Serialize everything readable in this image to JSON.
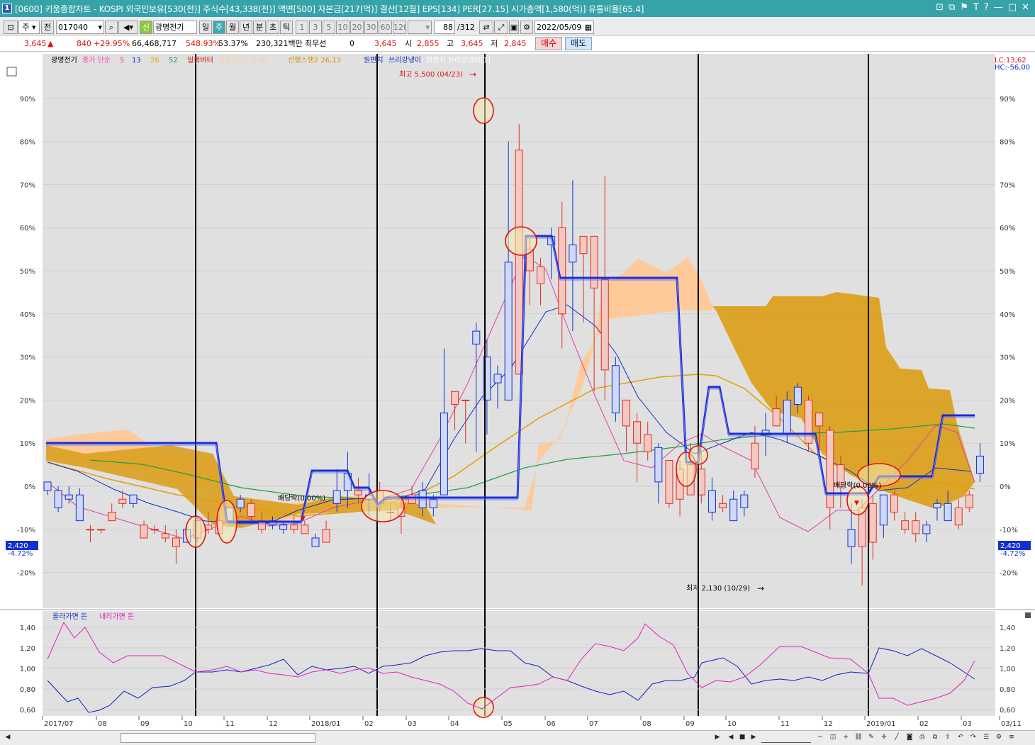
{
  "window": {
    "number": "1",
    "title": "[0600] 키움종합차트 - KOSPI 외국인보유[530(천)] 주식수[43,338(천)] 액면[500] 자본금[217(억)] 결산[12월] EPS[134] PER[27.15] 시가총액[1,580(억)] 유통비율[65.4]",
    "buttons": [
      "⊡",
      "⧉",
      "⚑",
      "T",
      "?",
      "—",
      "□",
      "✕"
    ]
  },
  "toolbar": {
    "period_type": "주",
    "period_all": "전",
    "code": "017040",
    "badge": "신",
    "name": "광명전기",
    "periods": [
      "일",
      "주",
      "월",
      "년",
      "분",
      "초",
      "틱"
    ],
    "active_period": "주",
    "intervals": [
      "1",
      "3",
      "5",
      "10",
      "20",
      "30",
      "60",
      "120"
    ],
    "count": "88",
    "count_total": "/312",
    "date": "2022/05/09"
  },
  "quote": {
    "price": "3,645",
    "change": "840",
    "change_pct": "+29.95%",
    "volume": "66,468,717",
    "vol_ratio": "548.93%",
    "turnover": "53.37%",
    "amount": "230,321백만",
    "pref_label": "최우선",
    "pref_value": "0",
    "bid_price": "3,645",
    "open_label": "시",
    "open": "2,855",
    "high_label": "고",
    "high": "3,645",
    "low_label": "저",
    "low": "2,845",
    "buy": "매수",
    "sell": "매도"
  },
  "legend": {
    "items": [
      {
        "text": "광명전기",
        "color": "#000000"
      },
      {
        "text": "종가 단순",
        "color": "#ff40c0"
      },
      {
        "text": "5",
        "color": "#e040a0"
      },
      {
        "text": "13",
        "color": "#1030c0"
      },
      {
        "text": "26",
        "color": "#e0a000"
      },
      {
        "text": "52",
        "color": "#10a040"
      },
      {
        "text": "일목버터",
        "color": "#e01010"
      },
      {
        "text": "선행스팬1 5.10",
        "color": "#ffcc99"
      },
      {
        "text": "선행스팬2 26,13",
        "color": "#d89000"
      },
      {
        "text": "원편치",
        "color": "#1030c0"
      },
      {
        "text": "쓰리강냉이",
        "color": "#1030c0"
      },
      {
        "text": "원편치 쓰리강냉이[1]",
        "color": "#ffffff"
      }
    ],
    "lc": "LC:13,62",
    "hc": "HC:-56,00"
  },
  "annotations": {
    "high": "최고 5,500 (04/23)",
    "low": "최저 2,130 (10/29)",
    "div1": "배당락(0.00%)",
    "div2": "배당락(0.00%)",
    "cur_price": "2,420",
    "cur_pct": "-4.72%"
  },
  "axis": {
    "y_ticks": [
      "90%",
      "80%",
      "70%",
      "60%",
      "50%",
      "40%",
      "30%",
      "20%",
      "10%",
      "0%",
      "-10%",
      "-20%"
    ],
    "x_ticks": [
      "2017/07",
      "08",
      "09",
      "10",
      "11",
      "12",
      "2018/01",
      "02",
      "03",
      "04",
      "05",
      "06",
      "07",
      "08",
      "09",
      "10",
      "11",
      "12",
      "2019/01",
      "02",
      "03",
      "03/11"
    ],
    "sub_ticks": [
      "1,40",
      "1,20",
      "1,00",
      "0,80",
      "0,60"
    ]
  },
  "sub_legend": {
    "up": "올라가면 돈",
    "down": "내리가면 돈"
  },
  "colors": {
    "up": "#e03020",
    "down": "#1030d0",
    "span1": "#ffc896",
    "span2": "#dca020",
    "title_bg": "#36a3a8"
  },
  "chart_data": {
    "type": "candlestick",
    "y_unit": "% relative to base price",
    "y_range": [
      -24,
      96
    ],
    "weeks": 88,
    "candles": [
      [
        1,
        -1,
        0,
        -2
      ],
      [
        -1,
        -5,
        0,
        -6
      ],
      [
        -2,
        -3,
        0,
        -4
      ],
      [
        -2,
        -8,
        -0.5,
        -8
      ],
      [
        -10,
        -10,
        -9,
        -13
      ],
      [
        -10,
        -10,
        -10,
        -11
      ],
      [
        -8,
        -6,
        -4,
        -8
      ],
      [
        -4,
        -3,
        -1,
        -5
      ],
      [
        -2,
        -4,
        -2,
        -5
      ],
      [
        -12,
        -9,
        -8,
        -12
      ],
      [
        -10,
        -10,
        -9,
        -11
      ],
      [
        -12,
        -11,
        -9,
        -13
      ],
      [
        -14,
        -12,
        -10,
        -18
      ],
      [
        -10,
        -13,
        -9,
        -13
      ],
      [
        -12,
        -8,
        -7,
        -13
      ],
      [
        -10,
        -9,
        -6,
        -11
      ],
      [
        -11,
        -8,
        -7,
        -11
      ],
      [
        -5,
        -8,
        -5,
        -9
      ],
      [
        -3,
        -5,
        -2,
        -6
      ],
      [
        -7,
        -4,
        -3,
        -8
      ],
      [
        -10,
        -8,
        -6,
        -11
      ],
      [
        -8,
        -9,
        -7,
        -10
      ],
      [
        -9,
        -10,
        -8,
        -11
      ],
      [
        -10,
        -9,
        -7,
        -11
      ],
      [
        -11,
        -9,
        -8,
        -11
      ],
      [
        -12,
        -14,
        -11,
        -14
      ],
      [
        -13,
        -10,
        -8,
        -13
      ],
      [
        -1,
        -4,
        4,
        -6
      ],
      [
        3,
        -1,
        8,
        -5
      ],
      [
        -2,
        -1,
        2,
        -4
      ],
      [
        -2,
        -3,
        3,
        -7
      ],
      [
        -4,
        -1,
        1,
        -6
      ],
      [
        -6,
        -6,
        -4,
        -8
      ],
      [
        -7,
        -5,
        -3,
        -11
      ],
      [
        -4,
        -2,
        0,
        -4
      ],
      [
        -1,
        -5,
        1,
        -7
      ],
      [
        -3,
        -5,
        -2,
        -7
      ],
      [
        17,
        -2,
        32,
        -2
      ],
      [
        19,
        22,
        22,
        13
      ],
      [
        20,
        20,
        20,
        10
      ],
      [
        36,
        33,
        38,
        8
      ],
      [
        30,
        20,
        34,
        12
      ],
      [
        26,
        24,
        28,
        18
      ],
      [
        52,
        20,
        80,
        20
      ],
      [
        26,
        78,
        84,
        26
      ],
      [
        50,
        55,
        58,
        42
      ],
      [
        47,
        51,
        53,
        42
      ],
      [
        58,
        56,
        60,
        48
      ],
      [
        40,
        60,
        66,
        32
      ],
      [
        56,
        52,
        71,
        36
      ],
      [
        54,
        58,
        58,
        38
      ],
      [
        46,
        58,
        58,
        22
      ],
      [
        27,
        48,
        72,
        20
      ],
      [
        28,
        17,
        30,
        15
      ],
      [
        14,
        20,
        20,
        8
      ],
      [
        10,
        15,
        17,
        1
      ],
      [
        8,
        12,
        15,
        6
      ],
      [
        9,
        1,
        10,
        -4
      ],
      [
        -4,
        6,
        6,
        -5
      ],
      [
        -3,
        4,
        6,
        -7
      ],
      [
        -2,
        5,
        10,
        -2
      ],
      [
        -2,
        4,
        8,
        -4
      ],
      [
        -1,
        -6,
        2,
        -8
      ],
      [
        -5,
        -4,
        -2,
        -6
      ],
      [
        -3,
        -8,
        -1,
        -8
      ],
      [
        -2,
        -5,
        -1,
        -7
      ],
      [
        4,
        10,
        14,
        2
      ],
      [
        13,
        12,
        17,
        7
      ],
      [
        14,
        18,
        21,
        14
      ],
      [
        20,
        12,
        22,
        10
      ],
      [
        23,
        19,
        24,
        17
      ],
      [
        10,
        20,
        21,
        8
      ],
      [
        14,
        17,
        17,
        8
      ],
      [
        -5,
        13,
        14,
        -10
      ],
      [
        0,
        5,
        7,
        -5
      ],
      [
        -10,
        -14,
        -4,
        -18
      ],
      [
        -14,
        -5,
        -3,
        -23
      ],
      [
        -13,
        -4,
        -2,
        -17
      ],
      [
        -2,
        -9,
        -5,
        -12
      ],
      [
        -6,
        -2,
        -1,
        -8
      ],
      [
        -10,
        -8,
        -6,
        -11
      ],
      [
        -11,
        -8,
        -6,
        -13
      ],
      [
        -9,
        -11,
        -8,
        -13
      ],
      [
        -4,
        -5,
        -3,
        -8
      ],
      [
        -4,
        -8,
        -1,
        -8
      ],
      [
        -9,
        -5,
        -3,
        -10
      ],
      [
        -5,
        -2,
        -1,
        -6
      ],
      [
        7,
        3,
        10,
        1
      ]
    ]
  }
}
